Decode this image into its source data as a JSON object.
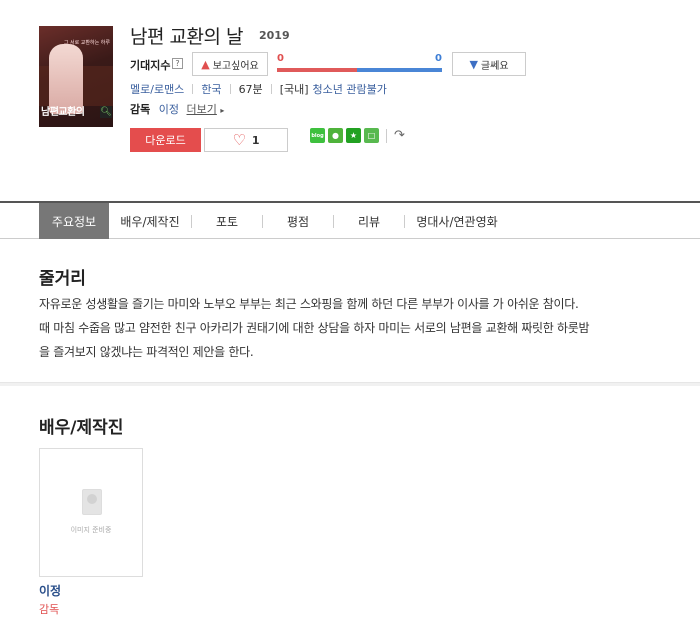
{
  "movie": {
    "title": "남편 교환의 날",
    "year": "2019",
    "poster": {
      "title": "남편교환의",
      "subtitle": "",
      "tagline": "그 서로 교환하는 하루"
    }
  },
  "expectation": {
    "label": "기대지수",
    "help_icon": "?",
    "want_label": "보고싶어요",
    "want_count": "0",
    "meh_label": "글쎄요",
    "meh_count": "0"
  },
  "meta": {
    "genre": "멜로/로맨스",
    "country": "한국",
    "runtime": "67분",
    "rating_prefix": "[국내]",
    "rating": "청소년 관람불가"
  },
  "director": {
    "label": "감독",
    "name": "이정",
    "more": "더보기"
  },
  "actions": {
    "download": "다운로드",
    "like_count": "1",
    "blog_label": "blog"
  },
  "tabs": [
    {
      "label": "주요정보"
    },
    {
      "label": "배우/제작진"
    },
    {
      "label": "포토"
    },
    {
      "label": "평점"
    },
    {
      "label": "리뷰"
    },
    {
      "label": "명대사/연관영화"
    }
  ],
  "synopsis": {
    "heading": "줄거리",
    "lines": [
      "자유로운 성생활을 즐기는 마미와 노부오 부부는 최근 스와핑을 함께 하던 다른 부부가 이사를 가 아쉬운 참이다.",
      "때 마침 수줍음 많고 얌전한 친구 아카리가 권태기에 대한 상담을 하자 마미는 서로의 남편을 교환해 짜릿한 하룻밤",
      "을 즐겨보지 않겠냐는 파격적인 제안을 한다."
    ]
  },
  "cast": {
    "heading": "배우/제작진",
    "items": [
      {
        "placeholder": "이미지 준비중",
        "name": "이정",
        "role": "감독"
      }
    ]
  },
  "colors": {
    "accent_red": "#e44d4d",
    "accent_blue": "#4a86d6",
    "link_blue": "#3a5f9e",
    "tab_active": "#777777"
  }
}
